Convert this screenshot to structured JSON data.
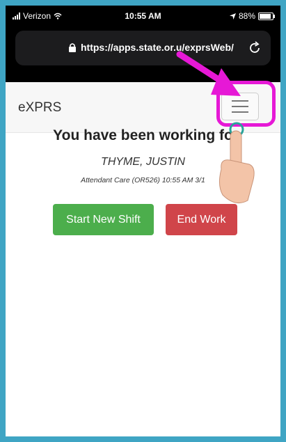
{
  "status_bar": {
    "carrier": "Verizon",
    "time": "10:55 AM",
    "battery": "88%",
    "battery_level": 0.88
  },
  "browser": {
    "url": "https://apps.state.or.u",
    "url_suffix": "/exprsWeb/"
  },
  "navbar": {
    "brand": "eXPRS"
  },
  "main": {
    "heading": "You have been working fo",
    "worker_name": "THYME, JUSTIN",
    "service_info": "Attendant Care (OR526) 10:55 AM 3/1",
    "start_button": "Start New Shift",
    "end_button": "End Work"
  },
  "colors": {
    "start_button": "#4cae4c",
    "end_button": "#d0454a",
    "highlight": "#e618d6",
    "frame_border": "#3fa5c4"
  },
  "icons": [
    "signal-icon",
    "wifi-icon",
    "location-arrow-icon",
    "battery-icon",
    "lock-icon",
    "reload-icon",
    "hamburger-menu-icon"
  ]
}
